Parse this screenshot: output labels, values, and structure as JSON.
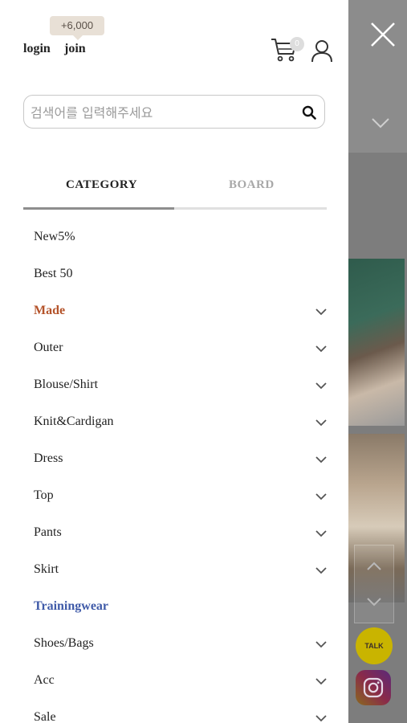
{
  "header": {
    "points_badge": "+6,000",
    "login": "login",
    "join": "join",
    "cart_count": "0"
  },
  "search": {
    "placeholder": "검색어를 입력해주세요"
  },
  "tabs": [
    {
      "label": "CATEGORY",
      "active": true
    },
    {
      "label": "BOARD",
      "active": false
    }
  ],
  "categories": [
    {
      "label": "New5%",
      "expandable": false
    },
    {
      "label": "Best 50",
      "expandable": false
    },
    {
      "label": "Made",
      "expandable": true
    },
    {
      "label": "Outer",
      "expandable": true
    },
    {
      "label": "Blouse/Shirt",
      "expandable": true
    },
    {
      "label": "Knit&Cardigan",
      "expandable": true
    },
    {
      "label": "Dress",
      "expandable": true
    },
    {
      "label": "Top",
      "expandable": true
    },
    {
      "label": "Pants",
      "expandable": true
    },
    {
      "label": "Skirt",
      "expandable": true
    },
    {
      "label": "Trainingwear",
      "expandable": false
    },
    {
      "label": "Shoes/Bags",
      "expandable": true
    },
    {
      "label": "Acc",
      "expandable": true
    },
    {
      "label": "Sale",
      "expandable": true
    }
  ],
  "floating": {
    "kakao_label": "TALK"
  },
  "colors": {
    "made": "#b4532a",
    "trainingwear": "#3f5aa8"
  },
  "icons": [
    "close-icon",
    "cart-icon",
    "user-icon",
    "search-icon",
    "chevron-down-icon",
    "chevron-up-icon",
    "kakao-talk-icon",
    "instagram-icon"
  ]
}
